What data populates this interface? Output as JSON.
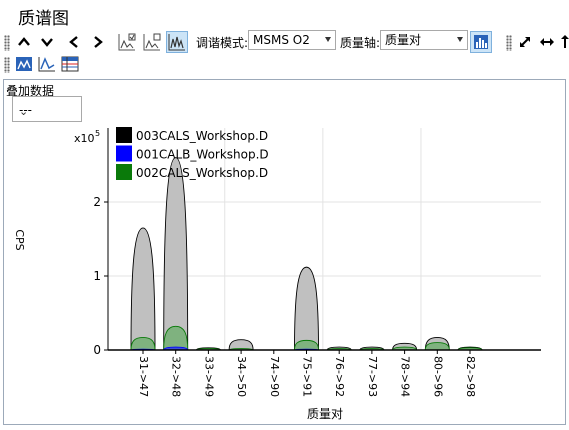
{
  "window": {
    "title": "质谱图"
  },
  "toolbar": {
    "tuning_mode_label": "调谐模式:",
    "tuning_mode_value": "MSMS O2",
    "mass_axis_label": "质量轴:",
    "mass_axis_value": "质量对"
  },
  "overlay": {
    "label": "叠加数据",
    "value": "---"
  },
  "chart_data": {
    "type": "area",
    "ylabel": "CPS",
    "xlabel": "质量对",
    "y_multiplier_label": "x10",
    "y_multiplier_exp": "5",
    "ylim": [
      0,
      3.0
    ],
    "yticks": [
      "0",
      "1",
      "2"
    ],
    "categories": [
      "31->47",
      "32->48",
      "33->49",
      "34->50",
      "74->90",
      "75->91",
      "76->92",
      "77->93",
      "78->94",
      "80->96",
      "82->98"
    ],
    "grid": true,
    "legend_position": "top-left",
    "series": [
      {
        "name": "003CALS_Workshop.D",
        "color": "#000000",
        "fill": "#c0c0c0",
        "values": [
          1.65,
          2.6,
          0.03,
          0.14,
          0.0,
          1.12,
          0.04,
          0.04,
          0.09,
          0.17,
          0.04
        ]
      },
      {
        "name": "001CALB_Workshop.D",
        "color": "#0000ff",
        "fill": "#3b4fd6",
        "values": [
          0.01,
          0.04,
          0.0,
          0.0,
          0.0,
          0.01,
          0.0,
          0.0,
          0.0,
          0.0,
          0.0
        ]
      },
      {
        "name": "002CALS_Workshop.D",
        "color": "#0a7a0a",
        "fill": "#7fb27f",
        "values": [
          0.17,
          0.32,
          0.02,
          0.02,
          0.0,
          0.13,
          0.02,
          0.02,
          0.04,
          0.1,
          0.03
        ]
      }
    ]
  }
}
